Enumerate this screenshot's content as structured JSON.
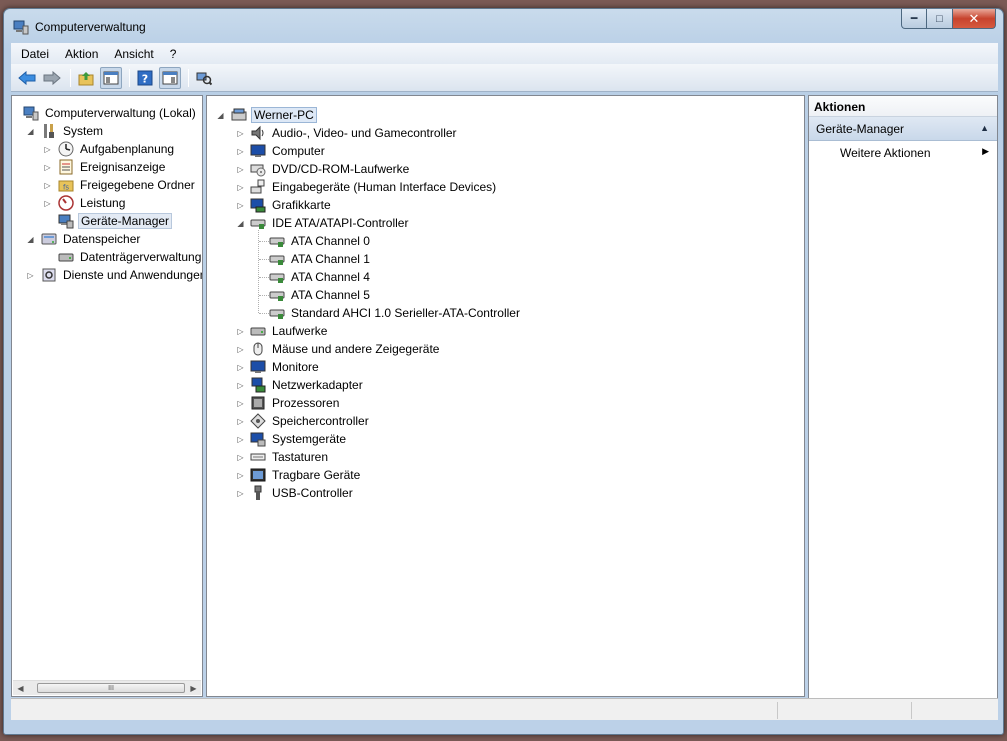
{
  "window": {
    "title": "Computerverwaltung"
  },
  "menu": [
    "Datei",
    "Aktion",
    "Ansicht",
    "?"
  ],
  "left_tree": [
    {
      "label": "Computerverwaltung (Lokal)",
      "icon": "computer-management-icon",
      "indent": 0,
      "twisty": ""
    },
    {
      "label": "System",
      "icon": "system-tools-icon",
      "indent": 1,
      "twisty": "expanded"
    },
    {
      "label": "Aufgabenplanung",
      "icon": "clock-icon",
      "indent": 2,
      "twisty": "collapsed"
    },
    {
      "label": "Ereignisanzeige",
      "icon": "event-viewer-icon",
      "indent": 2,
      "twisty": "collapsed"
    },
    {
      "label": "Freigegebene Ordner",
      "icon": "shared-folder-icon",
      "indent": 2,
      "twisty": "collapsed"
    },
    {
      "label": "Leistung",
      "icon": "performance-icon",
      "indent": 2,
      "twisty": "collapsed"
    },
    {
      "label": "Geräte-Manager",
      "icon": "device-manager-icon",
      "indent": 2,
      "twisty": "",
      "selected": true
    },
    {
      "label": "Datenspeicher",
      "icon": "storage-icon",
      "indent": 1,
      "twisty": "expanded"
    },
    {
      "label": "Datenträgerverwaltung",
      "icon": "disk-management-icon",
      "indent": 2,
      "twisty": ""
    },
    {
      "label": "Dienste und Anwendungen",
      "icon": "services-icon",
      "indent": 1,
      "twisty": "collapsed"
    }
  ],
  "device_tree": {
    "root": {
      "label": "Werner-PC",
      "icon": "computer-icon"
    },
    "categories": [
      {
        "label": "Audio-, Video- und Gamecontroller",
        "icon": "speaker-icon",
        "expanded": false
      },
      {
        "label": "Computer",
        "icon": "monitor-icon",
        "expanded": false
      },
      {
        "label": "DVD/CD-ROM-Laufwerke",
        "icon": "dvd-drive-icon",
        "expanded": false
      },
      {
        "label": "Eingabegeräte (Human Interface Devices)",
        "icon": "hid-icon",
        "expanded": false
      },
      {
        "label": "Grafikkarte",
        "icon": "display-adapter-icon",
        "expanded": false
      },
      {
        "label": "IDE ATA/ATAPI-Controller",
        "icon": "ide-controller-icon",
        "expanded": true,
        "children": [
          "ATA Channel 0",
          "ATA Channel 1",
          "ATA Channel 4",
          "ATA Channel 5",
          "Standard AHCI 1.0 Serieller-ATA-Controller"
        ]
      },
      {
        "label": "Laufwerke",
        "icon": "disk-drive-icon",
        "expanded": false
      },
      {
        "label": "Mäuse und andere Zeigegeräte",
        "icon": "mouse-icon",
        "expanded": false
      },
      {
        "label": "Monitore",
        "icon": "monitor-icon",
        "expanded": false
      },
      {
        "label": "Netzwerkadapter",
        "icon": "network-adapter-icon",
        "expanded": false
      },
      {
        "label": "Prozessoren",
        "icon": "processor-icon",
        "expanded": false
      },
      {
        "label": "Speichercontroller",
        "icon": "storage-controller-icon",
        "expanded": false
      },
      {
        "label": "Systemgeräte",
        "icon": "system-devices-icon",
        "expanded": false
      },
      {
        "label": "Tastaturen",
        "icon": "keyboard-icon",
        "expanded": false
      },
      {
        "label": "Tragbare Geräte",
        "icon": "portable-device-icon",
        "expanded": false
      },
      {
        "label": "USB-Controller",
        "icon": "usb-icon",
        "expanded": false
      }
    ]
  },
  "actions": {
    "header": "Aktionen",
    "section": "Geräte-Manager",
    "item": "Weitere Aktionen"
  },
  "scrollbar": {
    "thumb_grip": "III"
  },
  "colors": {
    "selection": "#dde8f6",
    "titlebar": "#c9dbec",
    "close_button": "#c7432d"
  }
}
